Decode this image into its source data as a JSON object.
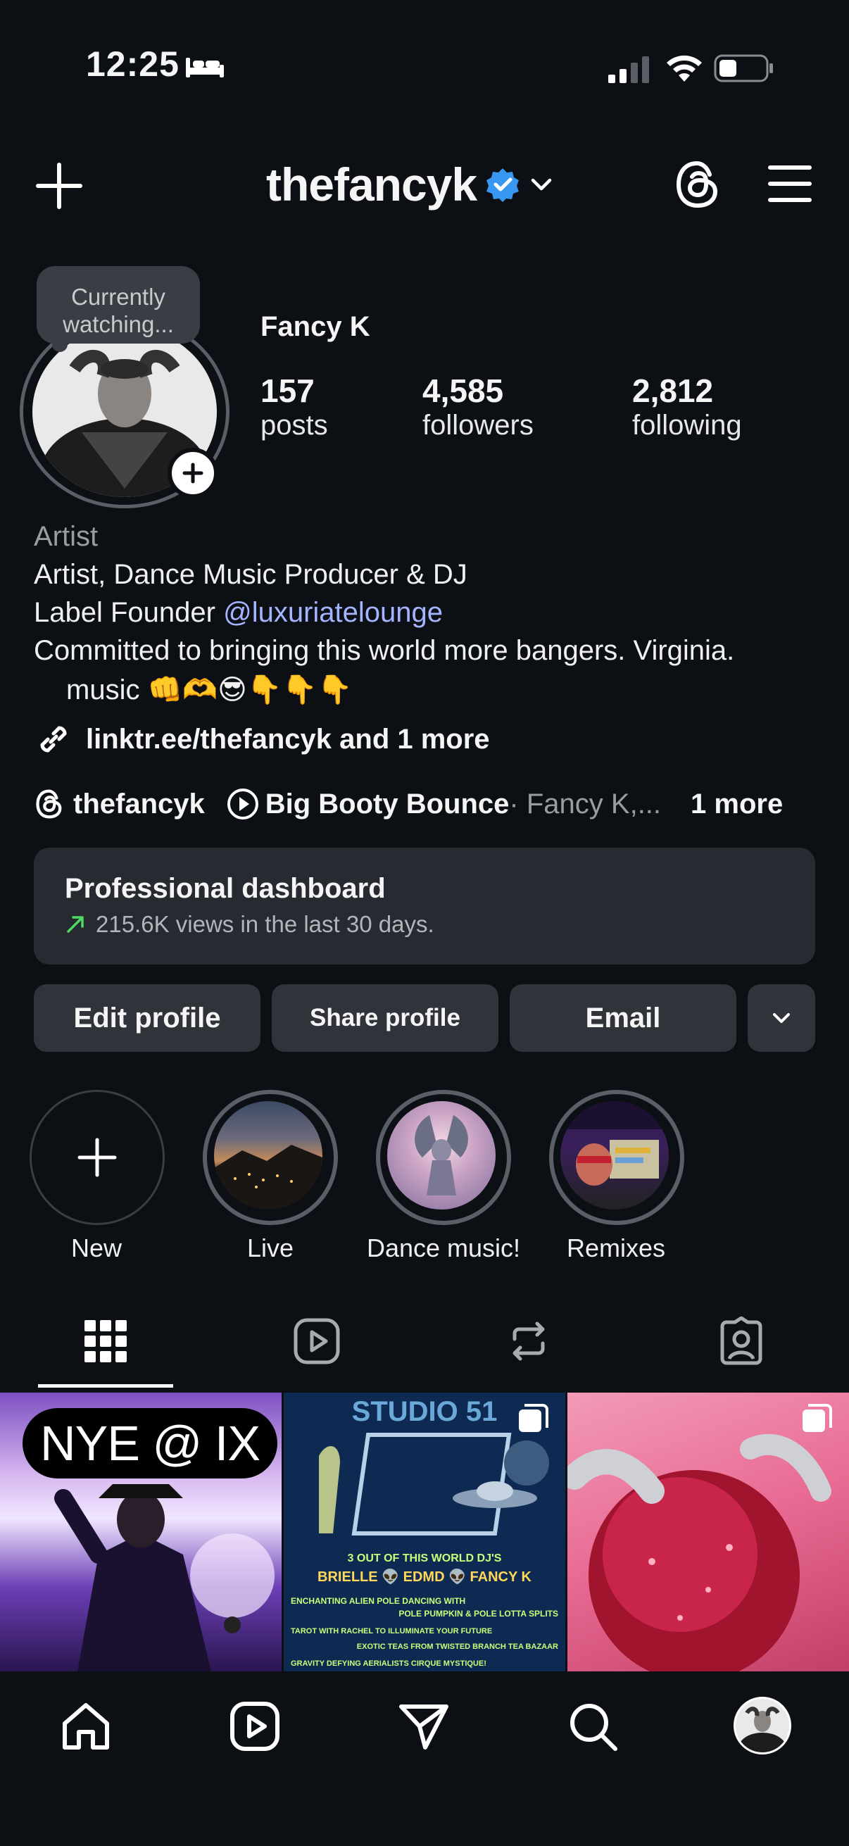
{
  "status_bar": {
    "time": "12:25"
  },
  "header": {
    "username": "thefancyk"
  },
  "profile": {
    "note": "Currently watching...",
    "display_name": "Fancy K",
    "stats": [
      {
        "value": "157",
        "label": "posts"
      },
      {
        "value": "4,585",
        "label": "followers"
      },
      {
        "value": "2,812",
        "label": "following"
      }
    ]
  },
  "bio": {
    "category": "Artist",
    "line1": "Artist, Dance Music Producer & DJ",
    "line2_prefix": "Label Founder ",
    "line2_mention": "@luxuriatelounge",
    "line3": "Committed to bringing this world more bangers. Virginia.",
    "line4": "music 👊🫶😎👇👇👇",
    "link": "linktr.ee/thefancyk and 1 more"
  },
  "chips": {
    "threads_handle": "thefancyk",
    "song_title": "Big Booty Bounce",
    "song_artist": " · Fancy K,...",
    "more": "1 more"
  },
  "dashboard": {
    "title": "Professional dashboard",
    "subtitle": "215.6K views in the last 30 days."
  },
  "buttons": {
    "edit": "Edit profile",
    "share": "Share profile",
    "email": "Email"
  },
  "highlights": [
    {
      "label": "New"
    },
    {
      "label": "Live"
    },
    {
      "label": "Dance music!"
    },
    {
      "label": "Remixes"
    }
  ],
  "posts": {
    "post1_caption": "NYE @ IX",
    "post2_title": "STUDIO 51",
    "post2_line1": "3 OUT OF THIS WORLD DJ'S",
    "post2_line2": "BRIELLE 👽 EDMD 👽 FANCY K",
    "post2_line3": "ENCHANTING ALIEN POLE DANCING WITH",
    "post2_line4": "POLE PUMPKIN & POLE LOTTA SPLITS",
    "post2_line5": "TAROT WITH RACHEL TO ILLUMINATE YOUR FUTURE",
    "post2_line6": "EXOTIC TEAS FROM TWISTED BRANCH TEA BAZAAR",
    "post2_line7": "GRAVITY DEFYING AERIALISTS CIRQUE MYSTIQUE!"
  },
  "colors": {
    "background": "#0c0f14",
    "surface": "#272a31",
    "button": "#30333a",
    "mention": "#a4b4ff",
    "verified": "#3897f0",
    "trend": "#4cd964"
  }
}
